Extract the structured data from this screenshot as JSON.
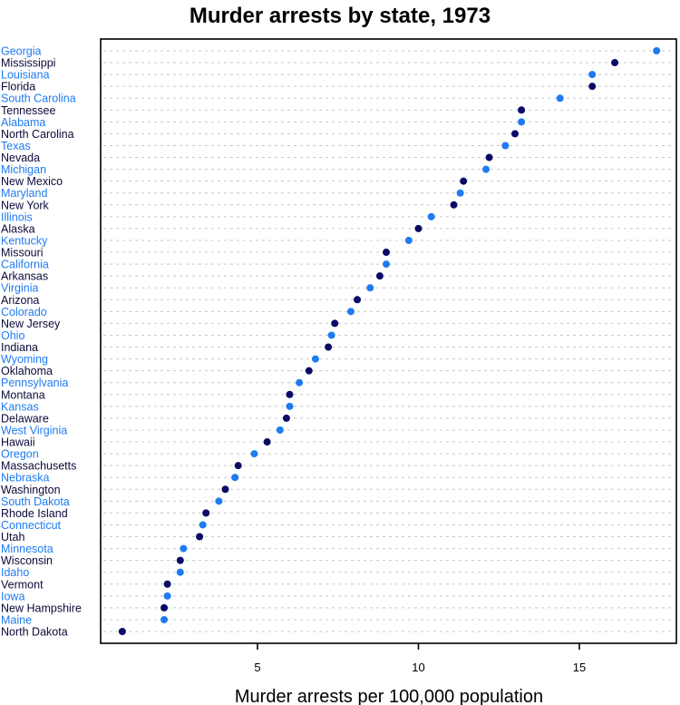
{
  "chart_data": {
    "type": "scatter",
    "subtype": "dotplot",
    "title": "Murder arrests by state, 1973",
    "xlabel": "Murder arrests per 100,000 population",
    "ylabel": "",
    "xlim": [
      0,
      18
    ],
    "xticks": [
      5,
      10,
      15
    ],
    "xtick_labels": [
      "5",
      "10",
      "15"
    ],
    "grid": "horizontal dotted",
    "legend": "none",
    "colors": {
      "odd_rows": "#1E7BF0",
      "even_rows": "#0A0A66",
      "label_odd": "#1E7BF0",
      "label_even": "#0A0A3A"
    },
    "categories": [
      "Georgia",
      "Mississippi",
      "Louisiana",
      "Florida",
      "South Carolina",
      "Tennessee",
      "Alabama",
      "North Carolina",
      "Texas",
      "Nevada",
      "Michigan",
      "New Mexico",
      "Maryland",
      "New York",
      "Illinois",
      "Alaska",
      "Kentucky",
      "Missouri",
      "California",
      "Arkansas",
      "Virginia",
      "Arizona",
      "Colorado",
      "New Jersey",
      "Ohio",
      "Indiana",
      "Wyoming",
      "Oklahoma",
      "Pennsylvania",
      "Montana",
      "Kansas",
      "Delaware",
      "West Virginia",
      "Hawaii",
      "Oregon",
      "Massachusetts",
      "Nebraska",
      "Washington",
      "South Dakota",
      "Rhode Island",
      "Connecticut",
      "Utah",
      "Minnesota",
      "Wisconsin",
      "Idaho",
      "Vermont",
      "Iowa",
      "New Hampshire",
      "Maine",
      "North Dakota"
    ],
    "values": [
      17.4,
      16.1,
      15.4,
      15.4,
      14.4,
      13.2,
      13.2,
      13.0,
      12.7,
      12.2,
      12.1,
      11.4,
      11.3,
      11.1,
      10.4,
      10.0,
      9.7,
      9.0,
      9.0,
      8.8,
      8.5,
      8.1,
      7.9,
      7.4,
      7.3,
      7.2,
      6.8,
      6.6,
      6.3,
      6.0,
      6.0,
      5.9,
      5.7,
      5.3,
      4.9,
      4.4,
      4.3,
      4.0,
      3.8,
      3.4,
      3.3,
      3.2,
      2.7,
      2.6,
      2.6,
      2.2,
      2.2,
      2.1,
      2.1,
      0.8
    ]
  }
}
